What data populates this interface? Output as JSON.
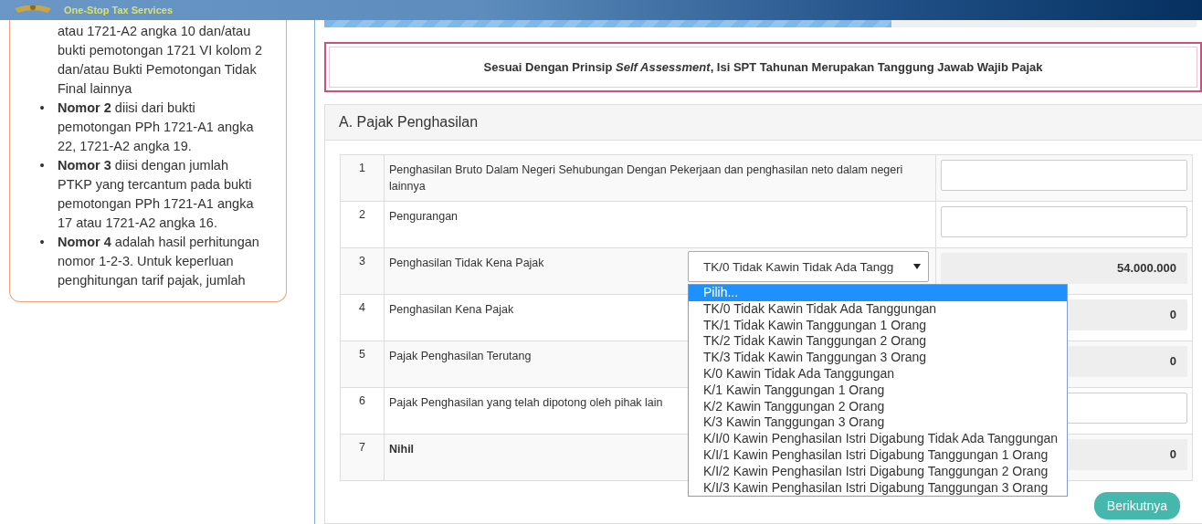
{
  "header": {
    "tagline": "One-Stop Tax Services"
  },
  "sidebar": {
    "items": [
      {
        "kind": "continuation",
        "text": "atau 1721-A2 angka 10 dan/atau bukti pemotongan 1721 VI kolom 2 dan/atau Bukti Pemotongan Tidak Final lainnya"
      },
      {
        "kind": "bullet",
        "marker": "•",
        "text": "**Nomor 2** diisi dari bukti pemotongan PPh 1721-A1 angka 22, 1721-A2 angka 19."
      },
      {
        "kind": "bullet",
        "marker": "•",
        "text": "**Nomor 3** diisi dengan jumlah PTKP yang tercantum pada bukti pemotongan PPh 1721-A1 angka 17 atau 1721-A2 angka 16."
      },
      {
        "kind": "bullet",
        "marker": "•",
        "text": "**Nomor 4** adalah hasil perhitungan nomor 1-2-3. Untuk keperluan penghitungan tarif pajak, jumlah"
      }
    ]
  },
  "progress": {
    "level": 0.65
  },
  "notice": "Sesuai Dengan Prinsip *Self Assessment*, Isi SPT Tahunan Merupakan Tanggung Jawab Wajib Pajak",
  "section": {
    "title": "A. Pajak Penghasilan",
    "rows": [
      {
        "number": "1",
        "label": "Penghasilan Bruto Dalam Negeri Sehubungan Dengan Pekerjaan dan penghasilan neto dalam negeri lainnya",
        "bold": false,
        "field": {
          "kind": "input"
        }
      },
      {
        "number": "2",
        "label": "Pengurangan",
        "bold": false,
        "field": {
          "kind": "input"
        }
      },
      {
        "number": "3",
        "label": "Penghasilan Tidak Kena Pajak",
        "bold": false,
        "select": {
          "value": "TK/0 Tidak Kawin Tidak Ada Tangg",
          "options": [
            {
              "label": "Pilih...",
              "selected": true
            },
            {
              "label": "TK/0 Tidak Kawin Tidak Ada Tanggungan",
              "selected": false
            },
            {
              "label": "TK/1 Tidak Kawin Tanggungan 1 Orang",
              "selected": false
            },
            {
              "label": "TK/2 Tidak Kawin Tanggungan 2 Orang",
              "selected": false
            },
            {
              "label": "TK/3 Tidak Kawin Tanggungan 3 Orang",
              "selected": false
            },
            {
              "label": "K/0 Kawin Tidak Ada Tanggungan",
              "selected": false
            },
            {
              "label": "K/1 Kawin Tanggungan 1 Orang",
              "selected": false
            },
            {
              "label": "K/2 Kawin Tanggungan 2 Orang",
              "selected": false
            },
            {
              "label": "K/3 Kawin Tanggungan 3 Orang",
              "selected": false
            },
            {
              "label": "K/I/0 Kawin Penghasilan Istri Digabung Tidak Ada Tanggungan",
              "selected": false
            },
            {
              "label": "K/I/1 Kawin Penghasilan Istri Digabung Tanggungan 1 Orang",
              "selected": false
            },
            {
              "label": "K/I/2 Kawin Penghasilan Istri Digabung Tanggungan 2 Orang",
              "selected": false
            },
            {
              "label": "K/I/3 Kawin Penghasilan Istri Digabung Tanggungan 3 Orang",
              "selected": false
            }
          ]
        },
        "field": {
          "kind": "readonly",
          "value": "54.000.000"
        }
      },
      {
        "number": "4",
        "label": "Penghasilan Kena Pajak",
        "bold": false,
        "field": {
          "kind": "readonly",
          "value": "0"
        }
      },
      {
        "number": "5",
        "label": "Pajak Penghasilan Terutang",
        "bold": false,
        "field": {
          "kind": "readonly",
          "value": "0"
        }
      },
      {
        "number": "6",
        "label": "Pajak Penghasilan yang telah dipotong oleh pihak lain",
        "bold": false,
        "field": {
          "kind": "input"
        }
      },
      {
        "number": "7",
        "label": "Nihil",
        "bold": true,
        "field": {
          "kind": "readonly",
          "value": "0"
        }
      }
    ]
  },
  "next_button": "Berikutnya"
}
